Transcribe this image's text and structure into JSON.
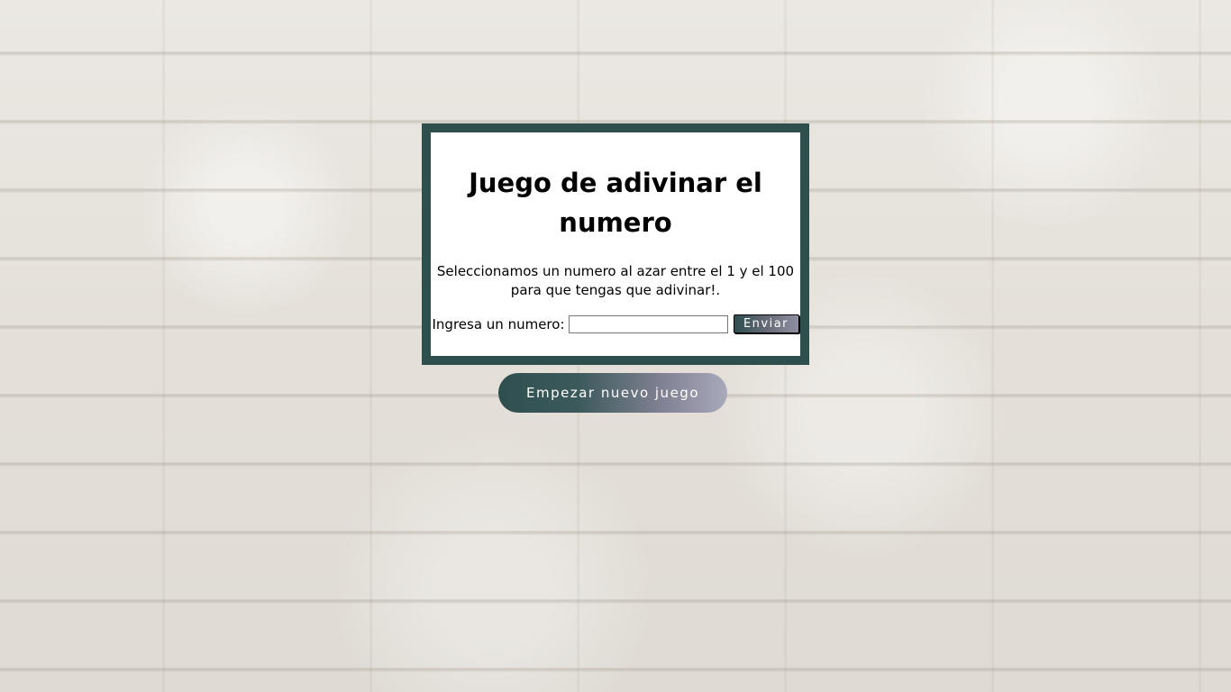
{
  "game": {
    "title": "Juego de adivinar el numero",
    "description": "Seleccionamos un numero al azar entre el 1 y el 100 para que tengas que adivinar!.",
    "input_label": "Ingresa un numero:",
    "input_value": "",
    "send_label": "Enviar",
    "new_game_label": "Empezar nuevo juego"
  },
  "colors": {
    "panel_border": "#2f4f4f",
    "panel_background": "#ffffff",
    "button_gradient_start": "#2f4f4f",
    "button_gradient_end": "#a9a9bc"
  }
}
